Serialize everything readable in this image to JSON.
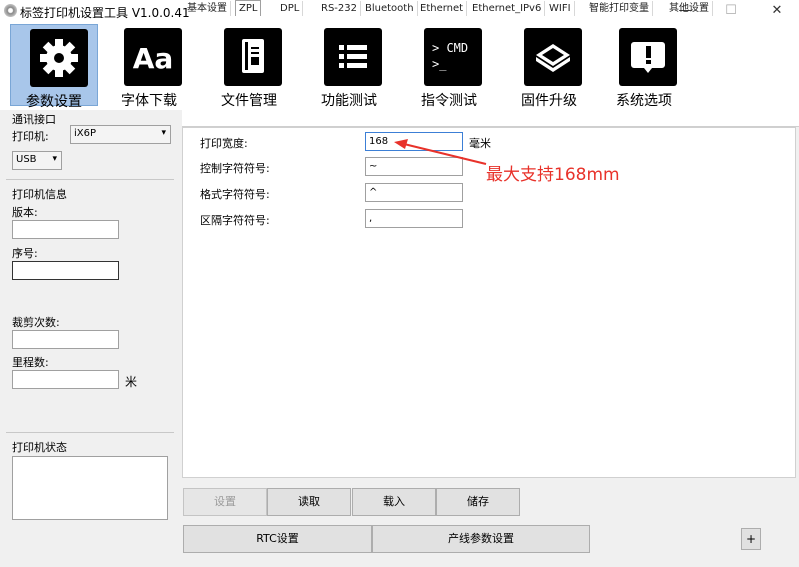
{
  "window": {
    "title": "标签打印机设置工具 V1.0.0.41",
    "min": "—",
    "max": "☐",
    "close": "✕"
  },
  "toolbar": [
    {
      "label": "参数设置",
      "icon": "gear-icon",
      "glyph": "⚙"
    },
    {
      "label": "字体下载",
      "icon": "font-icon",
      "glyph": "Aa"
    },
    {
      "label": "文件管理",
      "icon": "file-icon",
      "glyph": "▤"
    },
    {
      "label": "功能测试",
      "icon": "list-icon",
      "glyph": "☰"
    },
    {
      "label": "指令测试",
      "icon": "cmd-icon",
      "glyph": "> CMD\n>_"
    },
    {
      "label": "固件升级",
      "icon": "chip-icon",
      "glyph": "◈"
    },
    {
      "label": "系统选项",
      "icon": "alert-icon",
      "glyph": "!"
    }
  ],
  "sidebar": {
    "comm_title": "通讯接口",
    "printer_label": "打印机:",
    "printer_value": "iX6P",
    "port_value": "USB",
    "info_title": "打印机信息",
    "version_label": "版本:",
    "serial_label": "序号:",
    "cut_label": "裁剪次数:",
    "mileage_label": "里程数:",
    "mileage_unit": "米",
    "status_title": "打印机状态"
  },
  "tabs": [
    "基本设置",
    "ZPL",
    "DPL",
    "RS-232",
    "Bluetooth",
    "Ethernet",
    "Ethernet_IPv6",
    "WIFI",
    "智能打印变量",
    "其他设置"
  ],
  "form": {
    "width_label": "打印宽度:",
    "width_value": "168",
    "width_unit": "毫米",
    "ctrl_label": "控制字符符号:",
    "ctrl_value": "~",
    "fmt_label": "格式字符符号:",
    "fmt_value": "^",
    "sep_label": "区隔字符符号:",
    "sep_value": ","
  },
  "annotation": "最大支持168mm",
  "buttons": {
    "set": "设置",
    "read": "读取",
    "load": "载入",
    "save": "储存",
    "rtc": "RTC设置",
    "line": "产线参数设置",
    "plus": "+"
  },
  "colors": {
    "accent": "#a8c6ea",
    "annotation": "#e8322a"
  }
}
